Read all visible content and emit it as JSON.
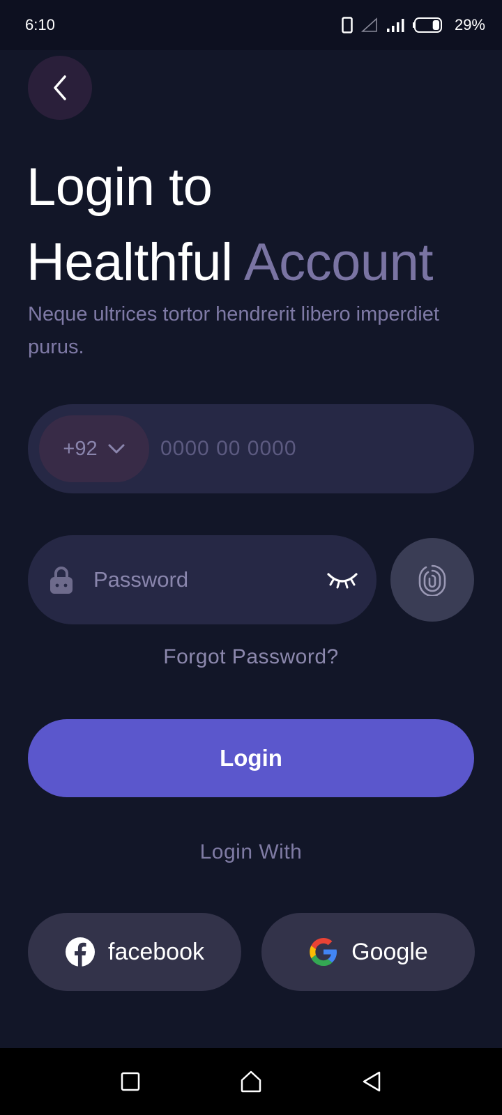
{
  "status_bar": {
    "time": "6:10",
    "battery_percent": "29%",
    "battery_level": 0.29,
    "icons": [
      "phone-icon",
      "no-signal-icon",
      "signal-icon",
      "battery-icon"
    ]
  },
  "header": {
    "back_icon": "chevron-left-icon",
    "title_line1": "Login to",
    "title_line2_main": "Healthful",
    "title_line2_accent": "Account",
    "subtitle": "Neque ultrices tortor hendrerit libero imperdiet purus."
  },
  "form": {
    "country_code": "+92",
    "phone_placeholder": "0000 00 0000",
    "password_placeholder": "Password",
    "forgot_password": "Forgot Password?",
    "login_label": "Login"
  },
  "social": {
    "login_with": "Login With",
    "facebook_label": "facebook",
    "google_label": "Google"
  },
  "colors": {
    "background": "#121628",
    "accent_text": "#7a74a3",
    "field": "#262845",
    "primary_button": "#5b57cc",
    "social_button": "#33334a"
  },
  "nav_bar": {
    "icons": [
      "recents-icon",
      "home-icon",
      "back-triangle-icon"
    ]
  }
}
